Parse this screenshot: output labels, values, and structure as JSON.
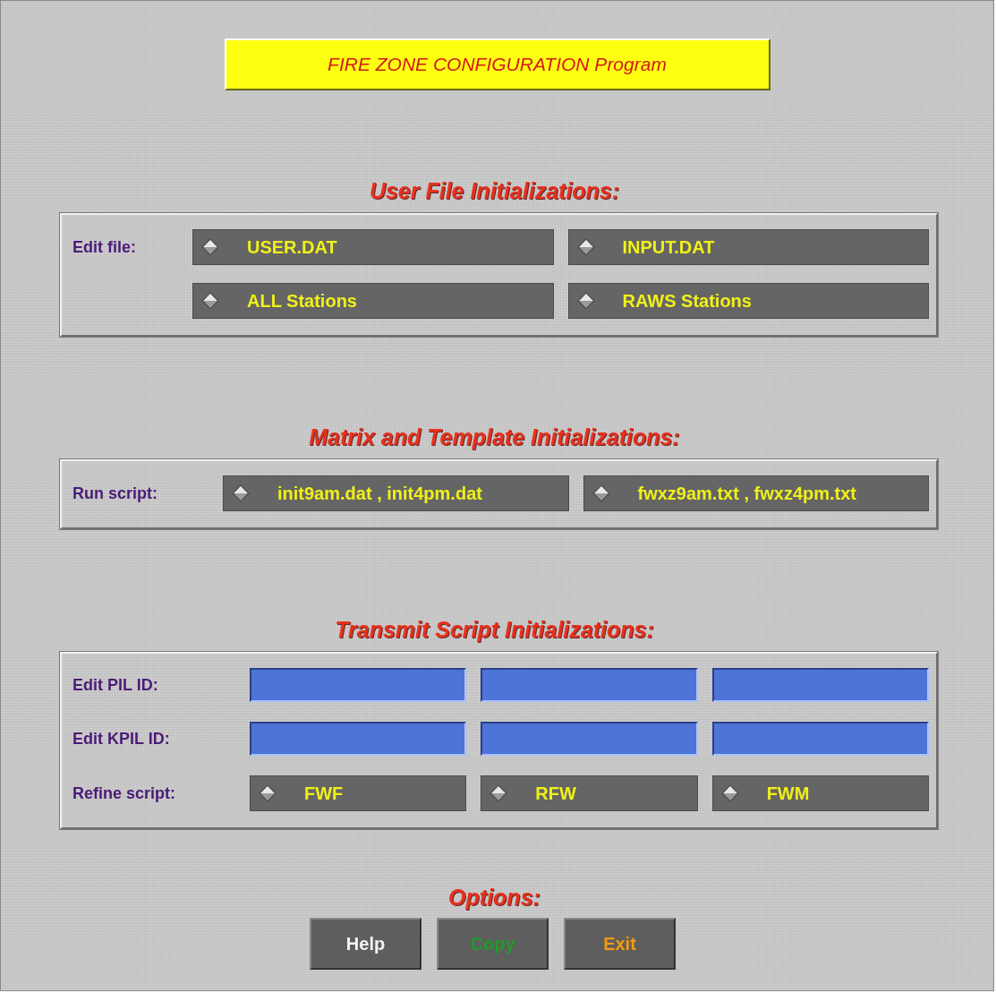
{
  "title": "FIRE ZONE CONFIGURATION Program",
  "sections": [
    {
      "heading": "User File Initializations:",
      "rows": [
        {
          "label": "Edit file:",
          "cells": [
            {
              "kind": "toggle",
              "text": "USER.DAT"
            },
            {
              "kind": "toggle",
              "text": "INPUT.DAT"
            }
          ]
        },
        {
          "cells": [
            {
              "kind": "toggle",
              "text": "ALL Stations"
            },
            {
              "kind": "toggle",
              "text": "RAWS Stations"
            }
          ]
        }
      ]
    },
    {
      "heading": "Matrix and Template Initializations:",
      "rows": [
        {
          "label": "Run script:",
          "cells": [
            {
              "kind": "toggle",
              "text": "init9am.dat , init4pm.dat"
            },
            {
              "kind": "toggle",
              "text": "fwxz9am.txt , fwxz4pm.txt"
            }
          ]
        }
      ]
    },
    {
      "heading": "Transmit Script Initializations:",
      "rows": [
        {
          "label": "Edit PIL ID:",
          "cells": [
            {
              "kind": "input"
            },
            {
              "kind": "input"
            },
            {
              "kind": "input"
            }
          ]
        },
        {
          "label": "Edit KPIL ID:",
          "cells": [
            {
              "kind": "input"
            },
            {
              "kind": "input"
            },
            {
              "kind": "input"
            }
          ]
        },
        {
          "label": "Refine script:",
          "cells": [
            {
              "kind": "toggle",
              "text": "FWF"
            },
            {
              "kind": "toggle",
              "text": "RFW"
            },
            {
              "kind": "toggle",
              "text": "FWM"
            }
          ]
        }
      ]
    }
  ],
  "options": {
    "heading": "Options:",
    "buttons": [
      {
        "label": "Help",
        "color": "#f4f4f4"
      },
      {
        "label": "Copy",
        "color": "#1f9a2a"
      },
      {
        "label": "Exit",
        "color": "#f39a10"
      }
    ]
  }
}
